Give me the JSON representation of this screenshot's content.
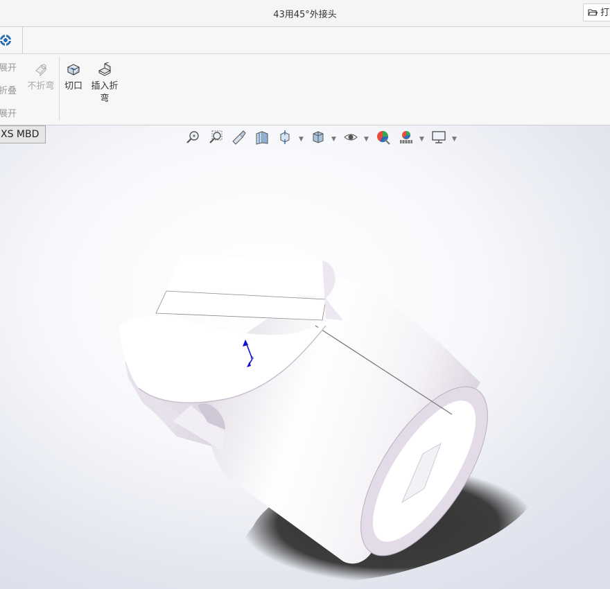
{
  "window": {
    "title": "43用45°外接头",
    "open_button_label": "打"
  },
  "ribbon": {
    "left_items": [
      "展开",
      "折叠",
      "展开"
    ],
    "buttons": {
      "no_bend": "不折弯",
      "cut": "切口",
      "insert_bend_line1": "插入折",
      "insert_bend_line2": "弯"
    }
  },
  "tabs": {
    "mbd": "XS MBD"
  },
  "heads_up_toolbar": {
    "icons": [
      "zoom-to-fit-icon",
      "zoom-to-area-icon",
      "previous-view-icon",
      "section-view-icon",
      "view-orientation-icon",
      "display-style-icon",
      "hide-show-items-icon",
      "edit-appearance-icon",
      "apply-scene-icon",
      "view-settings-icon"
    ]
  },
  "colors": {
    "model_face": "#ffffff",
    "model_shade": "#e4dbe8",
    "model_edge": "#7a7a7a",
    "shadow": "#3c3c3c",
    "triad_axis": "#1010d0"
  }
}
